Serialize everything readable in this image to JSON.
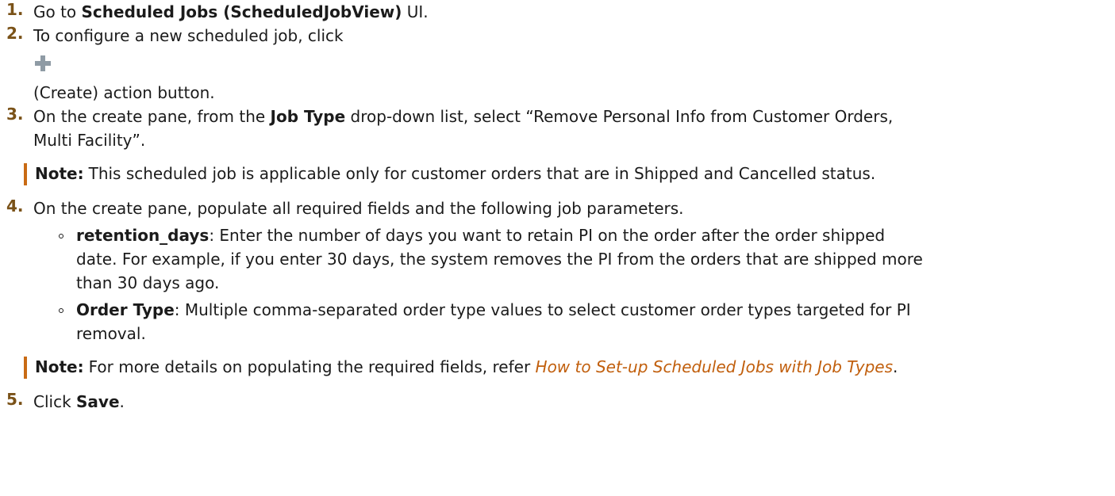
{
  "steps": [
    {
      "num": "1.",
      "pre": "Go to ",
      "bold": "Scheduled Jobs (ScheduledJobView)",
      "post": " UI."
    },
    {
      "num": "2.",
      "line1": "To configure a new scheduled job, click",
      "icon": "plus-icon",
      "line2": "(Create) action button."
    },
    {
      "num": "3.",
      "pre": "On the create pane, from the ",
      "bold": "Job Type",
      "post_line1": " drop-down list, select “Remove Personal Info from Customer Orders,",
      "post_line2": "Multi Facility”.",
      "note_label": "Note:",
      "note_text": "This scheduled job is applicable only for customer orders that are in Shipped and Cancelled status."
    },
    {
      "num": "4.",
      "text": "On the create pane, populate all required fields and the following job parameters.",
      "params": [
        {
          "name": "retention_days",
          "line1": ": Enter the number of days you want to retain PI on the order after the order shipped",
          "line2": "date. For example, if you enter 30 days, the system removes the PI from the orders that are shipped more",
          "line3": "than 30 days ago."
        },
        {
          "name": "Order Type",
          "line1": ": Multiple comma-separated order type values to select customer order types targeted for PI",
          "line2": "removal."
        }
      ],
      "note_label": "Note:",
      "note_text": "For more details on populating the required fields, refer ",
      "note_link": "How to Set-up Scheduled Jobs with Job Types",
      "note_end": "."
    },
    {
      "num": "5.",
      "pre": "Click ",
      "bold": "Save",
      "post": "."
    }
  ],
  "colors": {
    "number": "#7a5218",
    "note_bar": "#c96b14",
    "link": "#c15f0d",
    "icon": "#8f9ba5"
  }
}
